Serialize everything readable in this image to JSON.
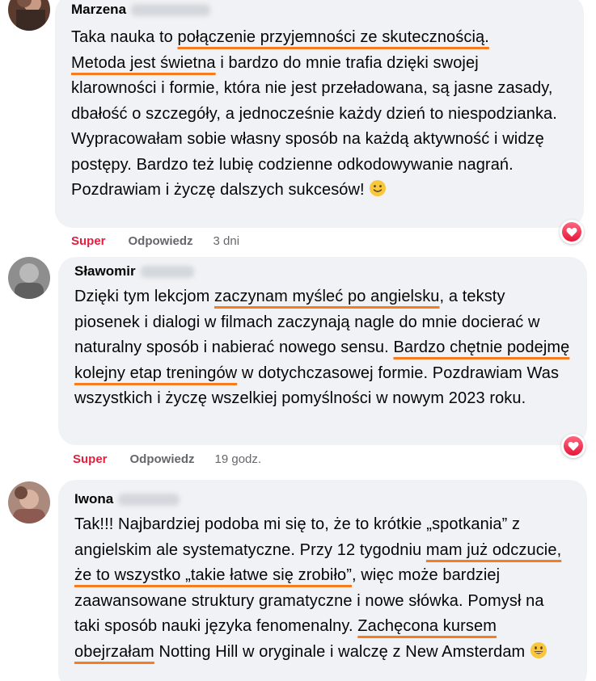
{
  "comments": [
    {
      "author": "Marzena",
      "segments": [
        {
          "t": "Taka nauka to ",
          "u": false
        },
        {
          "t": "połączenie przyjemności ze skutecznością.",
          "u": true
        },
        {
          "t": " ",
          "u": false
        },
        {
          "t": "Metoda jest świetna",
          "u": true
        },
        {
          "t": " i bardzo do mnie trafia dzięki swojej klarowności i formie, która nie jest przeładowana, są jasne zasady, dbałość o szczegóły, a jednocześnie każdy dzień to niespodzianka. Wypracowałam sobie własny sposób na każdą aktywność i widzę postępy. Bardzo też lubię codzienne odkodowywanie nagrań. Pozdrawiam i życzę dalszych sukcesów! ",
          "u": false
        }
      ],
      "trailing_emoji": "slightly-smiling-face-emoji",
      "reaction_label": "Super",
      "reply_label": "Odpowiedz",
      "time": "3 dni",
      "reaction_icon": "love-reaction-icon"
    },
    {
      "author": "Sławomir",
      "segments": [
        {
          "t": "Dzięki tym lekcjom ",
          "u": false
        },
        {
          "t": "zaczynam myśleć po angielsku",
          "u": true
        },
        {
          "t": ", a teksty piosenek i dialogi w filmach zaczynają nagle do mnie docierać w naturalny sposób i nabierać nowego sensu. ",
          "u": false
        },
        {
          "t": "Bardzo chętnie podejmę kolejny etap treningów",
          "u": true
        },
        {
          "t": " w dotychczasowej formie. Pozdrawiam Was wszystkich i życzę wszelkiej pomyślności w nowym 2023 roku.",
          "u": false
        }
      ],
      "trailing_emoji": "",
      "reaction_label": "Super",
      "reply_label": "Odpowiedz",
      "time": "19 godz.",
      "reaction_icon": "love-reaction-icon"
    },
    {
      "author": "Iwona",
      "segments": [
        {
          "t": "Tak!!! Najbardziej podoba mi się to, że to krótkie „spotkania” z angielskim ale systematyczne. Przy 12 tygodniu ",
          "u": false
        },
        {
          "t": "mam już odczucie, że to wszystko „takie łatwe się zrobiło”",
          "u": true
        },
        {
          "t": ", więc może bardziej zaawansowane struktury gramatyczne i nowe słówka. Pomysł na taki sposób nauki języka fenomenalny. ",
          "u": false
        },
        {
          "t": "Zachęcona kursem obejrzałam",
          "u": true
        },
        {
          "t": " Notting Hill w oryginale i walczę z New Amsterdam ",
          "u": false
        }
      ],
      "trailing_emoji": "grinning-face-emoji",
      "reaction_label": "",
      "reply_label": "",
      "time": "",
      "reaction_icon": ""
    }
  ],
  "colors": {
    "bubble": "#f0f2f5",
    "underline": "#f57c20",
    "reaction": "#e41e3f",
    "meta": "#65676b"
  }
}
